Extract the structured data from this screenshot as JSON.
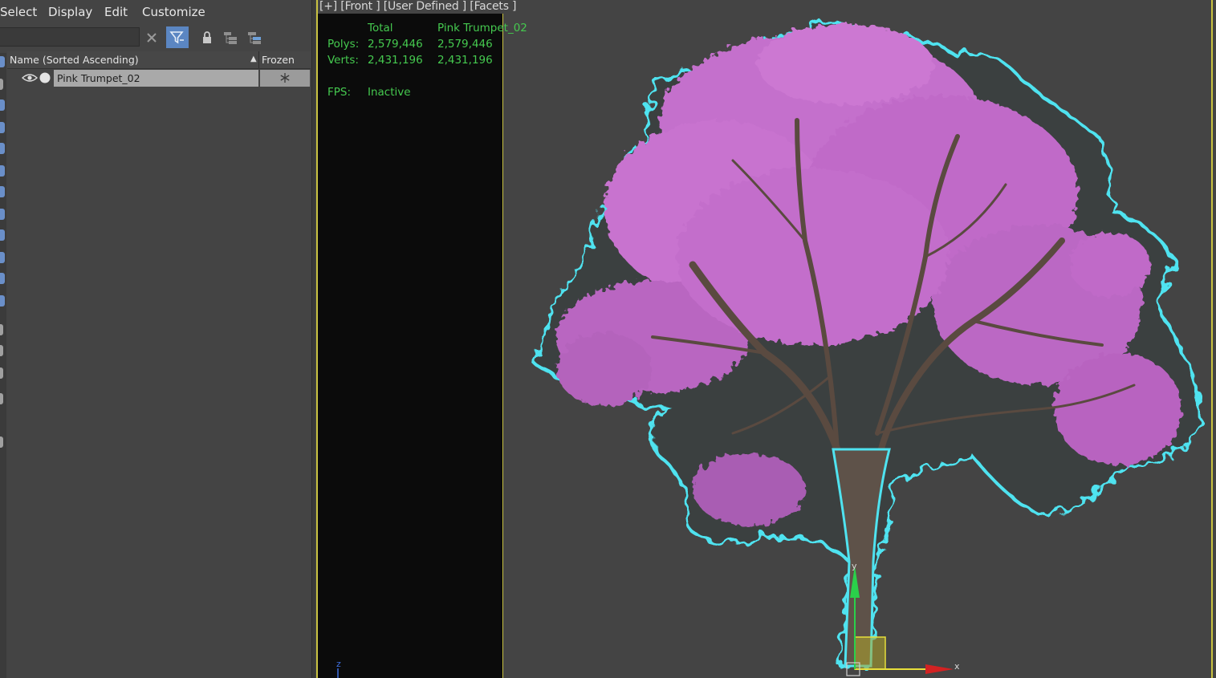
{
  "menu": [
    "Select",
    "Display",
    "Edit",
    "Customize"
  ],
  "search": {
    "placeholder": ""
  },
  "toolbar": {
    "clear_icon": "close-icon",
    "filter_icon": "funnel-icon",
    "lock_icon": "lock-icon",
    "hierarchy_icon": "hierarchy-icon",
    "layers_icon": "layers-icon"
  },
  "explorer": {
    "columns": {
      "name": "Name (Sorted Ascending)",
      "frozen": "Frozen"
    },
    "rows": [
      {
        "name": "Pink Trumpet_02",
        "visible": true,
        "frozen_icon": "snowflake-icon"
      }
    ]
  },
  "viewport": {
    "label": "[+] [Front ] [User Defined ] [Facets ]",
    "stats": {
      "col_total": "Total",
      "col_object": "Pink Trumpet_02",
      "polys_label": "Polys:",
      "polys_total": "2,579,446",
      "polys_object": "2,579,446",
      "verts_label": "Verts:",
      "verts_total": "2,431,196",
      "verts_object": "2,431,196",
      "fps_label": "FPS:",
      "fps_value": "Inactive"
    },
    "object": "Pink Trumpet_02",
    "axes": {
      "x": "x",
      "y": "y",
      "z": "z"
    },
    "colors": {
      "selection": "#4fe3f0",
      "blossom": "#d27ad8",
      "bark": "#5a4a40",
      "viewport_border": "#c9c241",
      "stats_text": "#45c94f"
    }
  }
}
